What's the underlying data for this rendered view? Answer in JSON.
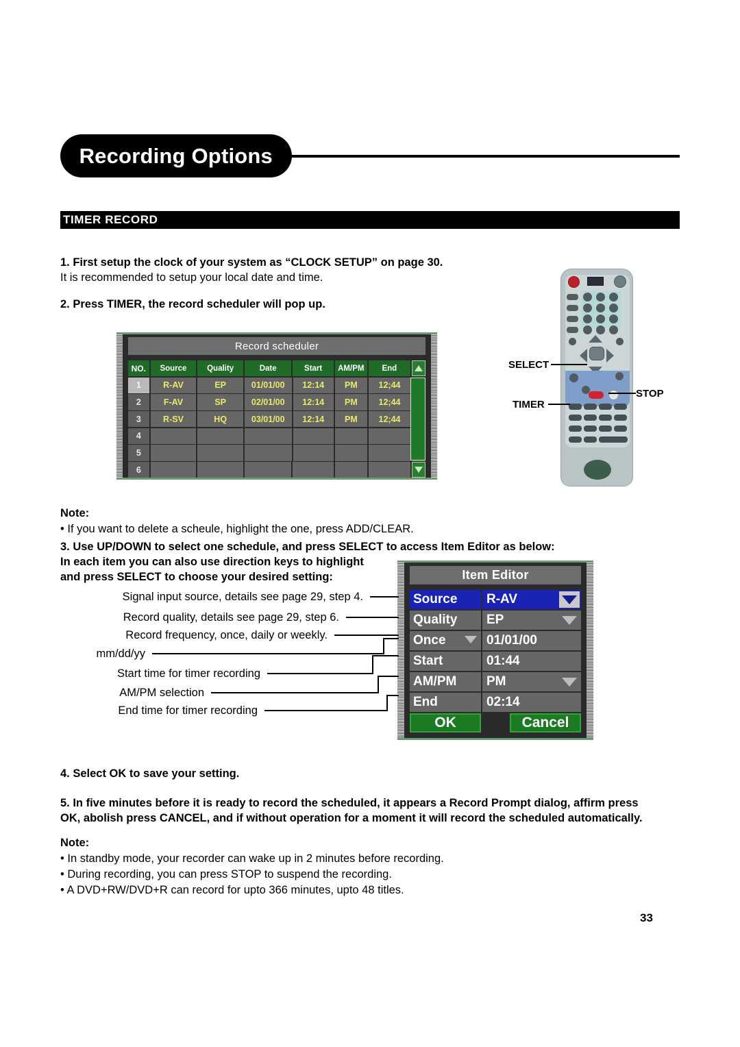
{
  "header": {
    "title": "Recording Options",
    "section_title": "TIMER RECORD"
  },
  "steps": {
    "step1_head": "1. First setup the clock of your system as “CLOCK SETUP” on page 30.",
    "step1_sub": "It is recommended to setup your local date and time.",
    "step2_head": "2. Press TIMER, the record scheduler will pop up.",
    "step3_line1": "3. Use UP/DOWN to select one schedule, and press SELECT to access Item Editor as below:",
    "step3_line2": "In each item you can also use direction keys to highlight",
    "step3_line3": "and press SELECT to choose your desired setting:",
    "step4_head": "4. Select OK to save your setting.",
    "step5_line1": "5. In five minutes before it is ready to record the scheduled, it appears a Record Prompt dialog, affirm press",
    "step5_line2": "OK, abolish press CANCEL, and if without operation for a moment it will record the scheduled automatically."
  },
  "note1": {
    "heading": "Note:",
    "bullets": [
      "• If you want to delete a scheule, highlight the one, press ADD/CLEAR."
    ]
  },
  "note2": {
    "heading": "Note:",
    "bullets": [
      "• In standby mode, your recorder can wake up in 2 minutes before recording.",
      "• During recording, you can press STOP to suspend the recording.",
      "• A DVD+RW/DVD+R can record for upto 366 minutes, upto 48 titles."
    ]
  },
  "scheduler": {
    "title": "Record scheduler",
    "columns": [
      "NO.",
      "Source",
      "Quality",
      "Date",
      "Start",
      "AM/PM",
      "End"
    ],
    "rows": [
      {
        "no": "1",
        "source": "R-AV",
        "quality": "EP",
        "date": "01/01/00",
        "start": "12:14",
        "ampm": "PM",
        "end": "12;44",
        "selected": true
      },
      {
        "no": "2",
        "source": "F-AV",
        "quality": "SP",
        "date": "02/01/00",
        "start": "12:14",
        "ampm": "PM",
        "end": "12;44",
        "selected": false
      },
      {
        "no": "3",
        "source": "R-SV",
        "quality": "HQ",
        "date": "03/01/00",
        "start": "12:14",
        "ampm": "PM",
        "end": "12;44",
        "selected": false
      },
      {
        "no": "4",
        "source": "",
        "quality": "",
        "date": "",
        "start": "",
        "ampm": "",
        "end": "",
        "selected": false
      },
      {
        "no": "5",
        "source": "",
        "quality": "",
        "date": "",
        "start": "",
        "ampm": "",
        "end": "",
        "selected": false
      },
      {
        "no": "6",
        "source": "",
        "quality": "",
        "date": "",
        "start": "",
        "ampm": "",
        "end": "",
        "selected": false
      }
    ],
    "scroll_up_icon": "triangle-up-icon",
    "scroll_down_icon": "triangle-down-icon"
  },
  "item_editor": {
    "title": "Item Editor",
    "fields": [
      {
        "label": "Source",
        "value": "R-AV",
        "highlighted": true,
        "arrow": "dropdown-arrow-blue"
      },
      {
        "label": "Quality",
        "value": "EP",
        "highlighted": false,
        "arrow": "dropdown-arrow-pale"
      },
      {
        "label": "Once",
        "value": "01/01/00",
        "highlighted": false,
        "arrow": "label-dropdown-arrow"
      },
      {
        "label": "Start",
        "value": "01:44",
        "highlighted": false,
        "arrow": "none"
      },
      {
        "label": "AM/PM",
        "value": "PM",
        "highlighted": false,
        "arrow": "dropdown-arrow-pale"
      },
      {
        "label": "End",
        "value": "02:14",
        "highlighted": false,
        "arrow": "none"
      }
    ],
    "ok_label": "OK",
    "cancel_label": "Cancel"
  },
  "callouts": [
    "Signal input source, details see page 29, step 4.",
    "Record quality, details see page 29, step 6.",
    "Record frequency, once, daily or weekly.",
    "mm/dd/yy",
    "Start time for timer recording",
    "AM/PM selection",
    "End time for timer recording"
  ],
  "remote_callouts": {
    "select": "SELECT",
    "stop": "STOP",
    "timer": "TIMER"
  },
  "page_number": "33",
  "colors": {
    "header_bar": "#000000",
    "screen_green_header": "#1f6b27",
    "screen_cell_gray": "#666666",
    "screen_value_yellow": "#e9e96a",
    "editor_highlight_blue": "#1b23b5",
    "button_green": "#1b7a22",
    "remote_body": "#b9c4c6",
    "remote_power_red": "#c0202a",
    "remote_keypad_teal": "#b6d8d6",
    "remote_blue_zone": "#7f9ec9"
  }
}
